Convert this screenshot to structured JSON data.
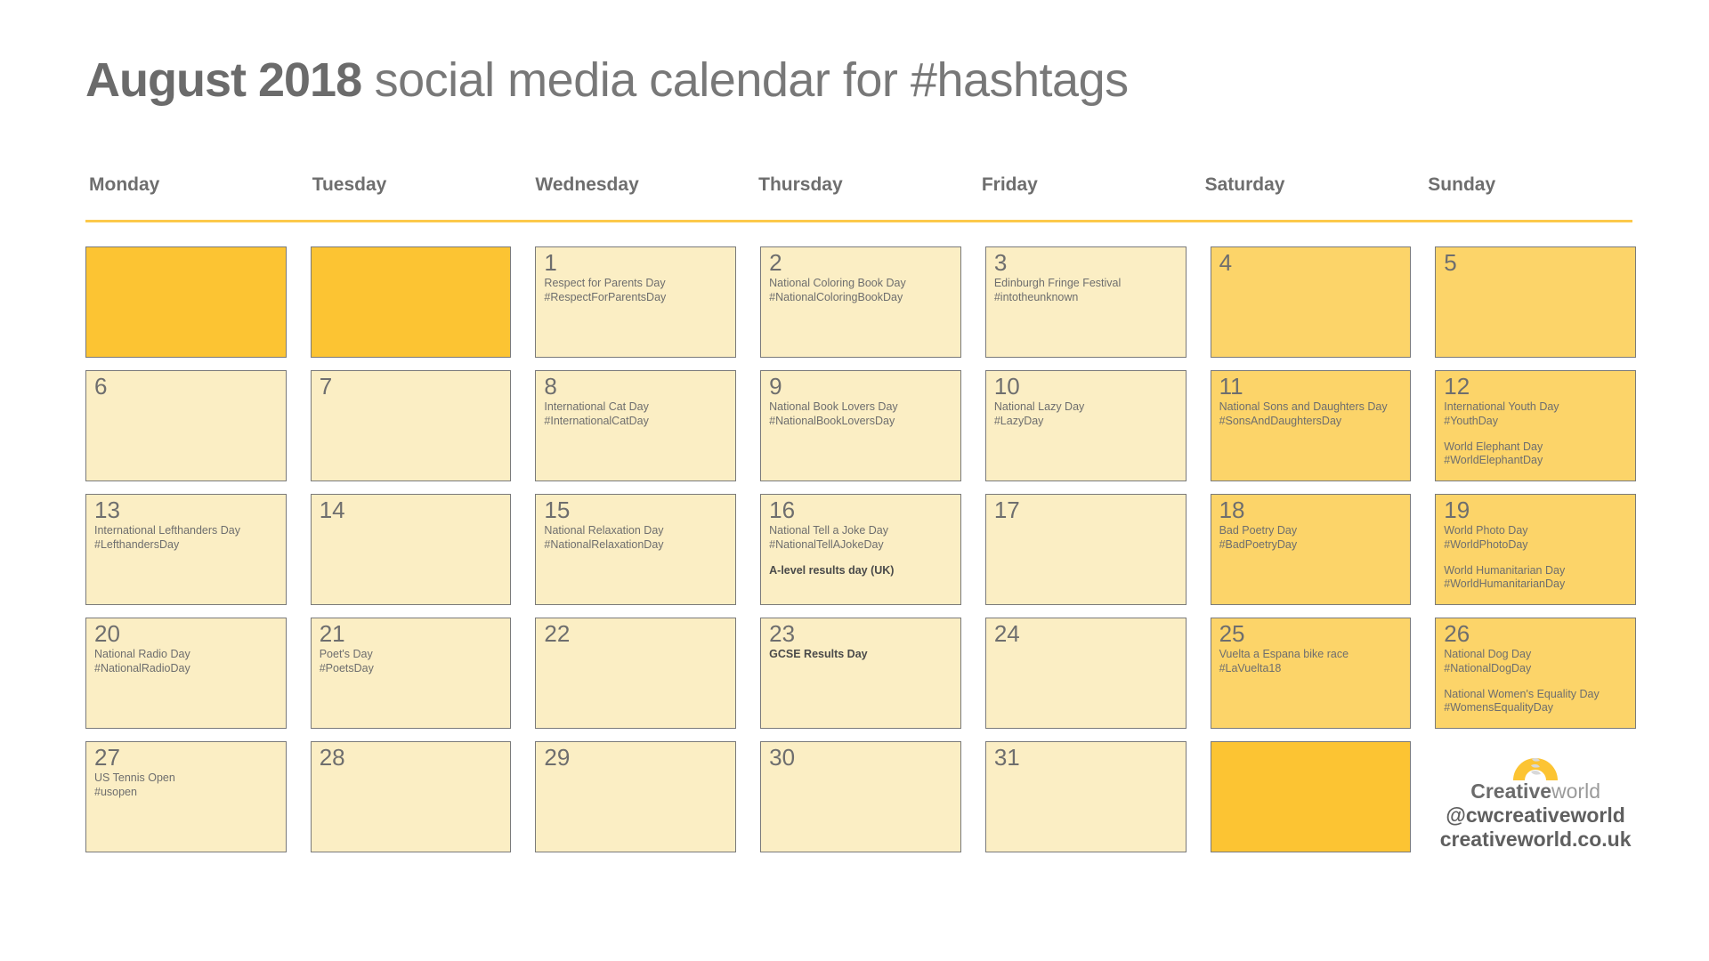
{
  "title": {
    "month_year": "August 2018",
    "rest": " social media calendar for #hashtags"
  },
  "weekdays": [
    "Monday",
    "Tuesday",
    "Wednesday",
    "Thursday",
    "Friday",
    "Saturday",
    "Sunday"
  ],
  "colors": {
    "pale": "#fbeec4",
    "deep": "#fcd469",
    "bright": "#fcc433",
    "text": "#6e6e6e",
    "rule": "#fcc94a",
    "border": "#7a7a7a"
  },
  "weeks": [
    [
      {
        "day": "",
        "tone": "bright",
        "events": []
      },
      {
        "day": "",
        "tone": "bright",
        "events": []
      },
      {
        "day": "1",
        "tone": "pale",
        "events": [
          {
            "name": "Respect for Parents Day",
            "tag": "#RespectForParentsDay"
          }
        ]
      },
      {
        "day": "2",
        "tone": "pale",
        "events": [
          {
            "name": "National Coloring Book Day",
            "tag": "#NationalColoringBookDay"
          }
        ]
      },
      {
        "day": "3",
        "tone": "pale",
        "events": [
          {
            "name": "Edinburgh Fringe Festival",
            "tag": "#intotheunknown"
          }
        ]
      },
      {
        "day": "4",
        "tone": "deep",
        "events": []
      },
      {
        "day": "5",
        "tone": "deep",
        "events": []
      }
    ],
    [
      {
        "day": "6",
        "tone": "pale",
        "events": []
      },
      {
        "day": "7",
        "tone": "pale",
        "events": []
      },
      {
        "day": "8",
        "tone": "pale",
        "events": [
          {
            "name": "International Cat Day",
            "tag": "#InternationalCatDay"
          }
        ]
      },
      {
        "day": "9",
        "tone": "pale",
        "events": [
          {
            "name": "National Book Lovers Day",
            "tag": "#NationalBookLoversDay"
          }
        ]
      },
      {
        "day": "10",
        "tone": "pale",
        "events": [
          {
            "name": "National Lazy Day",
            "tag": "#LazyDay"
          }
        ]
      },
      {
        "day": "11",
        "tone": "deep",
        "events": [
          {
            "name": "National Sons and Daughters Day",
            "tag": "#SonsAndDaughtersDay"
          }
        ]
      },
      {
        "day": "12",
        "tone": "deep",
        "events": [
          {
            "name": " International Youth Day",
            "tag": "#YouthDay"
          },
          {
            "name": "World Elephant Day",
            "tag": "#WorldElephantDay"
          }
        ]
      }
    ],
    [
      {
        "day": "13",
        "tone": "pale",
        "events": [
          {
            "name": "International Lefthanders Day",
            "tag": "#LefthandersDay"
          }
        ]
      },
      {
        "day": "14",
        "tone": "pale",
        "events": []
      },
      {
        "day": "15",
        "tone": "pale",
        "events": [
          {
            "name": "National Relaxation Day",
            "tag": "#NationalRelaxationDay"
          }
        ]
      },
      {
        "day": "16",
        "tone": "pale",
        "events": [
          {
            "name": "National Tell a Joke Day",
            "tag": "#NationalTellAJokeDay"
          },
          {
            "name": "A-level results day (UK)",
            "tag": "",
            "bold": true
          }
        ]
      },
      {
        "day": "17",
        "tone": "pale",
        "events": []
      },
      {
        "day": "18",
        "tone": "deep",
        "events": [
          {
            "name": "Bad Poetry Day",
            "tag": "#BadPoetryDay"
          }
        ]
      },
      {
        "day": "19",
        "tone": "deep",
        "events": [
          {
            "name": "World Photo Day",
            "tag": "#WorldPhotoDay"
          },
          {
            "name": "World Humanitarian Day",
            "tag": "#WorldHumanitarianDay"
          }
        ]
      }
    ],
    [
      {
        "day": "20",
        "tone": "pale",
        "events": [
          {
            "name": "National Radio Day",
            "tag": "#NationalRadioDay"
          }
        ]
      },
      {
        "day": "21",
        "tone": "pale",
        "events": [
          {
            "name": "Poet's Day",
            "tag": "#PoetsDay"
          }
        ]
      },
      {
        "day": "22",
        "tone": "pale",
        "events": []
      },
      {
        "day": "23",
        "tone": "pale",
        "events": [
          {
            "name": "GCSE Results Day",
            "tag": "",
            "bold": true
          }
        ]
      },
      {
        "day": "24",
        "tone": "pale",
        "events": []
      },
      {
        "day": "25",
        "tone": "deep",
        "events": [
          {
            "name": "Vuelta a Espana bike race",
            "tag": "#LaVuelta18"
          }
        ]
      },
      {
        "day": "26",
        "tone": "deep",
        "events": [
          {
            "name": "National Dog Day",
            "tag": "#NationalDogDay"
          },
          {
            "name": "National Women's Equality Day",
            "tag": "#WomensEqualityDay"
          }
        ]
      }
    ],
    [
      {
        "day": "27",
        "tone": "pale",
        "events": [
          {
            "name": "US Tennis Open",
            "tag": "#usopen"
          }
        ]
      },
      {
        "day": "28",
        "tone": "pale",
        "events": []
      },
      {
        "day": "29",
        "tone": "pale",
        "events": []
      },
      {
        "day": "30",
        "tone": "pale",
        "events": []
      },
      {
        "day": "31",
        "tone": "pale",
        "events": []
      },
      {
        "day": "",
        "tone": "bright",
        "events": []
      },
      {
        "day": "",
        "tone": "logo",
        "events": []
      }
    ]
  ],
  "logo": {
    "brand_bold": "Creative",
    "brand_light": "world",
    "handle": "@cwcreativeworld",
    "url": "creativeworld.co.uk",
    "mark_color": "#fcc433"
  }
}
